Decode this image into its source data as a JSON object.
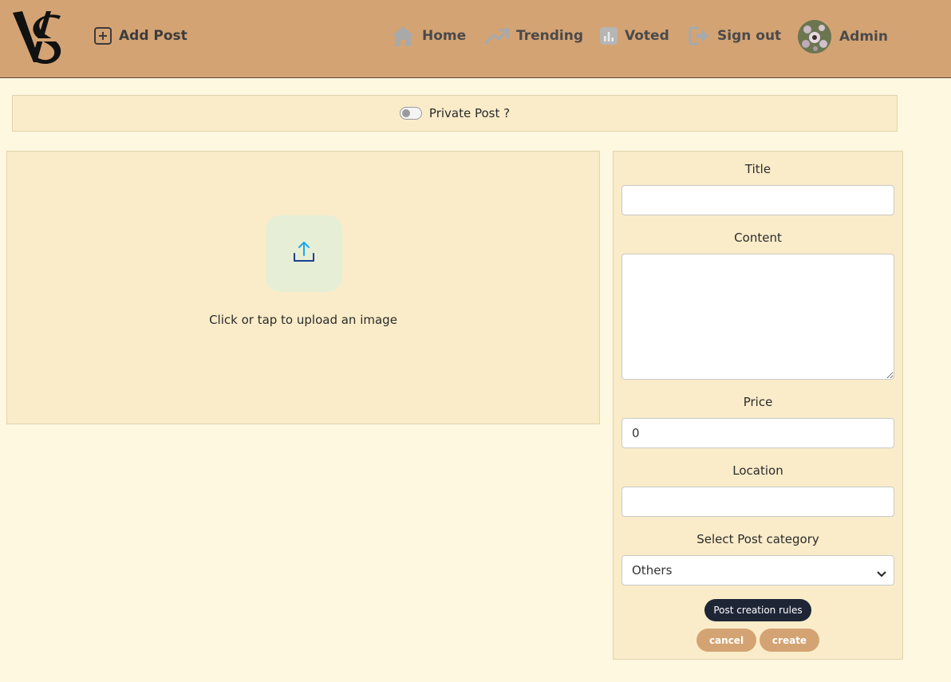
{
  "nav": {
    "add_post": "Add Post",
    "home": "Home",
    "trending": "Trending",
    "voted": "Voted",
    "sign_out": "Sign out",
    "admin": "Admin",
    "icons": {
      "add": "plus-square-icon",
      "home": "home-icon",
      "trending": "trending-up-icon",
      "voted": "bar-chart-icon",
      "sign_out": "sign-out-icon"
    }
  },
  "private_post": {
    "label": "Private Post ?",
    "enabled": false
  },
  "upload": {
    "text": "Click or tap to upload an image",
    "icon": "upload-icon"
  },
  "form": {
    "title_label": "Title",
    "title_value": "",
    "content_label": "Content",
    "content_value": "",
    "price_label": "Price",
    "price_value": "0",
    "location_label": "Location",
    "location_value": "",
    "category_label": "Select Post category",
    "category_selected": "Others"
  },
  "buttons": {
    "rules": "Post creation rules",
    "cancel": "cancel",
    "create": "create"
  },
  "colors": {
    "navbar": "#d4a373",
    "page_bg": "#fef8e1",
    "panel_bg": "#faecc9",
    "primary_button": "#d4a373",
    "dark_button": "#1e2636",
    "upload_icon": "#1ea7e8"
  }
}
